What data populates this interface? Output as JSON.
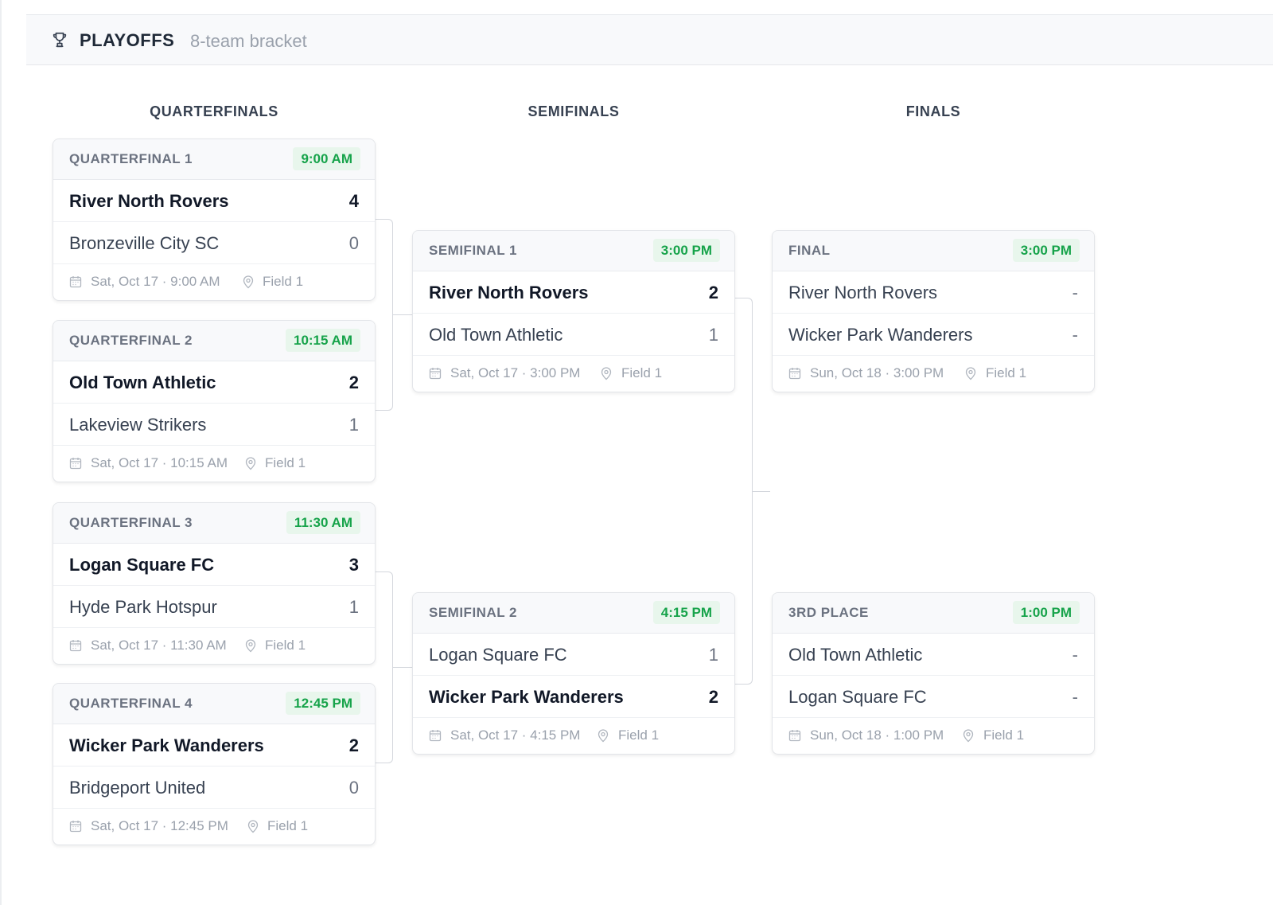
{
  "header": {
    "title": "PLAYOFFS",
    "subtitle": "8-team bracket"
  },
  "columns": {
    "quarterfinals": "QUARTERFINALS",
    "semifinals": "SEMIFINALS",
    "finals": "FINALS"
  },
  "matches": {
    "qf1": {
      "label": "QUARTERFINAL 1",
      "time": "9:00 AM",
      "teams": [
        {
          "name": "River North Rovers",
          "score": "4"
        },
        {
          "name": "Bronzeville City SC",
          "score": "0"
        }
      ],
      "date": "Sat, Oct 17 · 9:00 AM",
      "field": "Field 1"
    },
    "qf2": {
      "label": "QUARTERFINAL 2",
      "time": "10:15 AM",
      "teams": [
        {
          "name": "Old Town Athletic",
          "score": "2"
        },
        {
          "name": "Lakeview Strikers",
          "score": "1"
        }
      ],
      "date": "Sat, Oct 17 · 10:15 AM",
      "field": "Field 1"
    },
    "qf3": {
      "label": "QUARTERFINAL 3",
      "time": "11:30 AM",
      "teams": [
        {
          "name": "Logan Square FC",
          "score": "3"
        },
        {
          "name": "Hyde Park Hotspur",
          "score": "1"
        }
      ],
      "date": "Sat, Oct 17 · 11:30 AM",
      "field": "Field 1"
    },
    "qf4": {
      "label": "QUARTERFINAL 4",
      "time": "12:45 PM",
      "teams": [
        {
          "name": "Wicker Park Wanderers",
          "score": "2"
        },
        {
          "name": "Bridgeport United",
          "score": "0"
        }
      ],
      "date": "Sat, Oct 17 · 12:45 PM",
      "field": "Field 1"
    },
    "sf1": {
      "label": "SEMIFINAL 1",
      "time": "3:00 PM",
      "teams": [
        {
          "name": "River North Rovers",
          "score": "2"
        },
        {
          "name": "Old Town Athletic",
          "score": "1"
        }
      ],
      "date": "Sat, Oct 17 · 3:00 PM",
      "field": "Field 1"
    },
    "sf2": {
      "label": "SEMIFINAL 2",
      "time": "4:15 PM",
      "teams": [
        {
          "name": "Logan Square FC",
          "score": "1"
        },
        {
          "name": "Wicker Park Wanderers",
          "score": "2"
        }
      ],
      "date": "Sat, Oct 17 · 4:15 PM",
      "field": "Field 1"
    },
    "final": {
      "label": "FINAL",
      "time": "3:00 PM",
      "teams": [
        {
          "name": "River North Rovers",
          "score": "-"
        },
        {
          "name": "Wicker Park Wanderers",
          "score": "-"
        }
      ],
      "date": "Sun, Oct 18 · 3:00 PM",
      "field": "Field 1"
    },
    "third": {
      "label": "3RD PLACE",
      "time": "1:00 PM",
      "teams": [
        {
          "name": "Old Town Athletic",
          "score": "-"
        },
        {
          "name": "Logan Square FC",
          "score": "-"
        }
      ],
      "date": "Sun, Oct 18 · 1:00 PM",
      "field": "Field 1"
    }
  },
  "icons": {
    "header": "trophy-icon",
    "date": "calendar-icon",
    "location": "map-pin-icon"
  },
  "colors": {
    "time_badge_bg": "#e8f6ec",
    "time_badge_text": "#16a34a"
  }
}
